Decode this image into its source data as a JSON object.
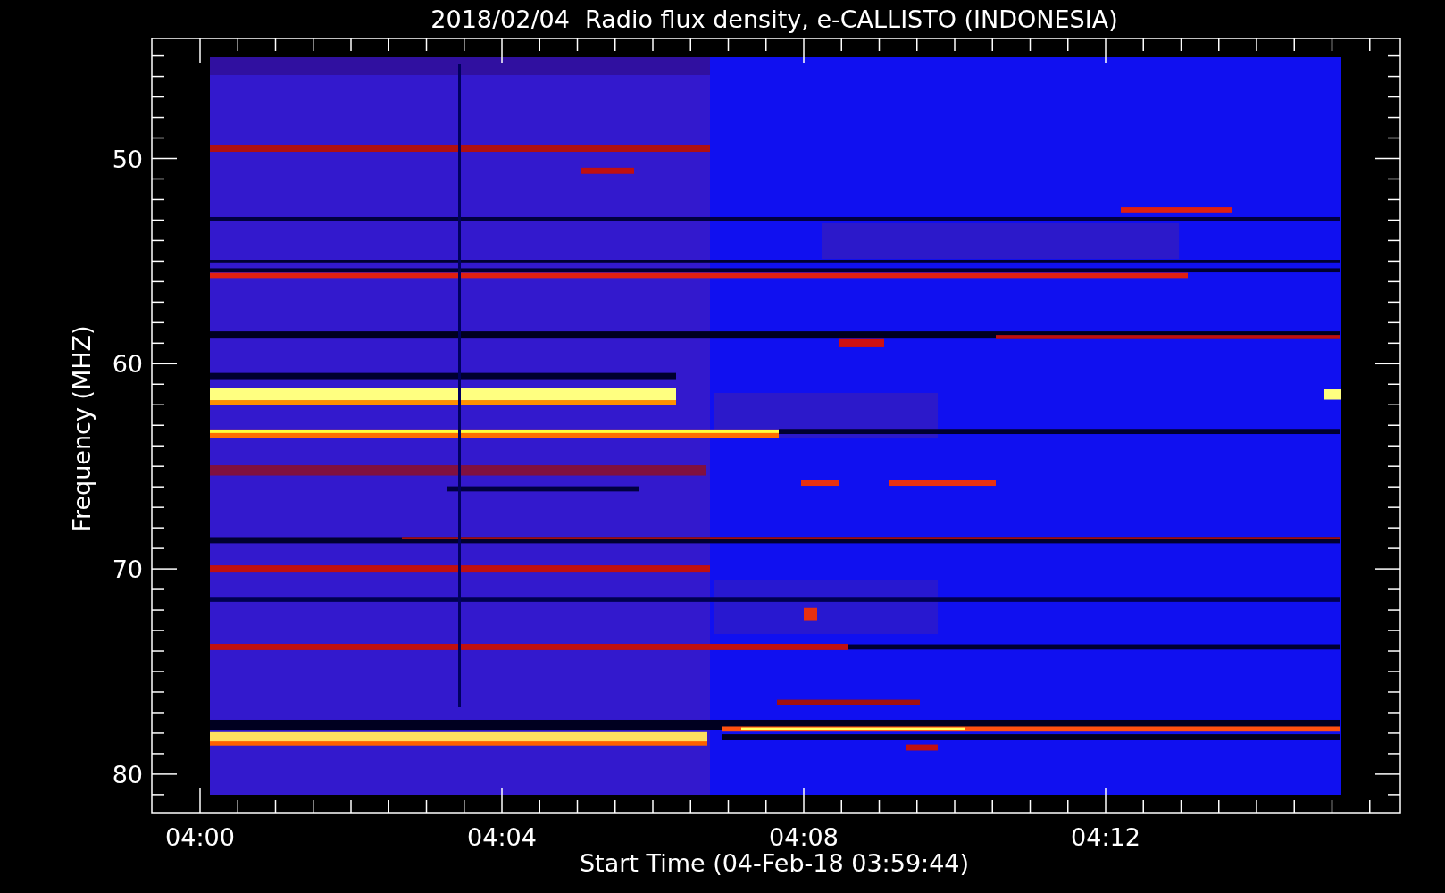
{
  "title": "2018/02/04  Radio flux density, e-CALLISTO (INDONESIA)",
  "y_axis": {
    "label": "Frequency (MHZ)",
    "ticks": [
      "50",
      "60",
      "70",
      "80"
    ]
  },
  "x_axis": {
    "label": "Start Time (04-Feb-18 03:59:44)",
    "ticks": [
      "04:00",
      "04:04",
      "04:08",
      "04:12"
    ]
  }
}
